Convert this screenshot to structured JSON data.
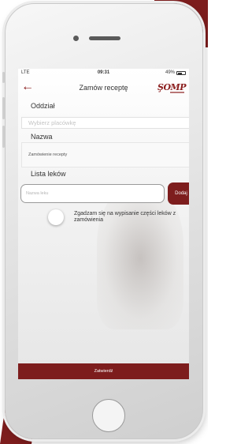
{
  "status": {
    "carrier": "LTE",
    "time": "09:31",
    "battery": "49%"
  },
  "header": {
    "title": "Zamów receptę",
    "logo": "ŞOMP"
  },
  "branch": {
    "label": "Oddział",
    "placeholder": "Wybierz placówkę"
  },
  "name": {
    "label": "Nazwa",
    "value": "Zamówienie recepty"
  },
  "drugs": {
    "label": "Lista leków",
    "input_placeholder": "Nazwa leku",
    "add_label": "Dodaj"
  },
  "consent": {
    "text": "Zgadzam się na wypisanie części leków z zamówienia",
    "checked": false
  },
  "footer": {
    "submit_label": "Zatwierdź"
  },
  "colors": {
    "accent": "#7d1d1d"
  }
}
